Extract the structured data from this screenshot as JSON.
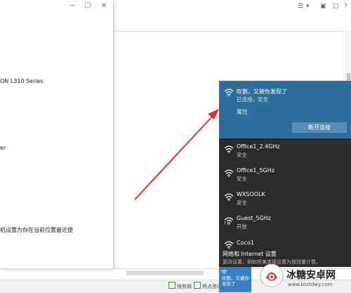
{
  "dialog": {
    "lines": [
      "ON L310 Series",
      "er",
      "机设置为你在当前位置最近使"
    ]
  },
  "flyout": {
    "connected": {
      "name": "叹鹅，又被你发现了",
      "status": "已连接，安全",
      "properties_label": "属性",
      "disconnect_label": "断开连接"
    },
    "networks": [
      {
        "name": "Office1_2.4GHz",
        "status": "安全"
      },
      {
        "name": "Office1_5GHz",
        "status": "安全"
      },
      {
        "name": "WXSOOLK",
        "status": "安全"
      },
      {
        "name": "Guest_5GHz",
        "status": "开放"
      },
      {
        "name": "Coco1",
        "status": ""
      }
    ],
    "settings_link": "网络和 Internet 设置",
    "settings_sub": "更改设置，例如将某连接设置为按流量计费。"
  },
  "tile": {
    "line1": "叹鹅，又被你",
    "line2": "发现了"
  },
  "taskbar": {
    "item1": "快剪辑",
    "item2": "热点资讯"
  },
  "watermark": {
    "name": "冰糖安卓网",
    "url": "www.btxtdwy.com"
  },
  "colors": {
    "flyout_bg": "#2b2b2b",
    "selected_bg": "#2d6e9d",
    "arrow": "#e03030",
    "tile": "#3a7fc0"
  }
}
